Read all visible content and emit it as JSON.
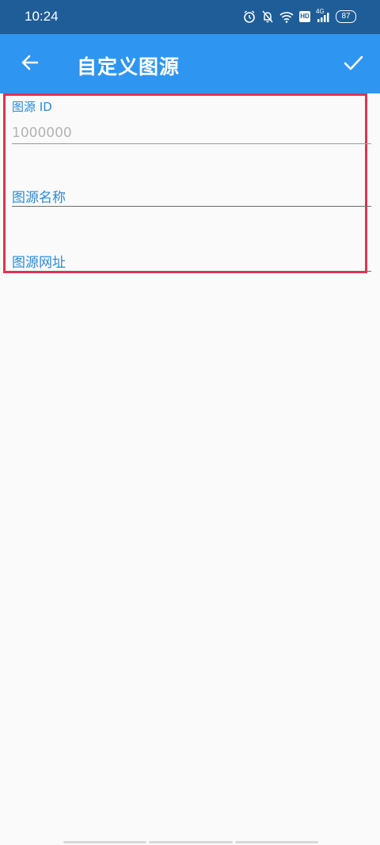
{
  "status_bar": {
    "time": "10:24",
    "icons": [
      "alarm-icon",
      "mute-bell-icon",
      "wifi-icon",
      "hd-icon",
      "4g-signal-icon",
      "battery-icon"
    ],
    "hd": "HD",
    "network": "4G",
    "battery": "87"
  },
  "app_bar": {
    "title": "自定义图源",
    "back_icon": "arrow-left-icon",
    "confirm_icon": "check-icon"
  },
  "form": {
    "source_id": {
      "label": "图源 ID",
      "placeholder": "1000000",
      "value": ""
    },
    "source_name": {
      "label": "图源名称",
      "value": ""
    },
    "source_url": {
      "label": "图源网址",
      "value": ""
    }
  },
  "colors": {
    "status_bar": "#1e5d98",
    "app_bar": "#2e95f0",
    "accent_label": "#2a8ad6",
    "highlight_border": "#e0344f",
    "background": "#fafafa"
  }
}
